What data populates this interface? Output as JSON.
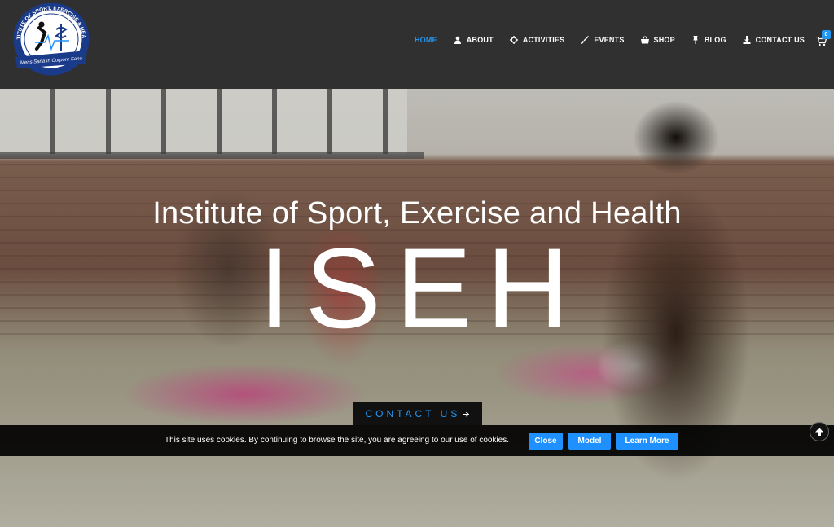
{
  "header": {
    "logo": {
      "ring_text": "INSTITUTE OF SPORT, EXERCISE & HEALTH",
      "motto": "Mens Sana In Corpore Sano",
      "colors": {
        "ring": "#1a3a8a",
        "banner": "#1a3a8a",
        "inner": "#ffffff"
      }
    },
    "nav": [
      {
        "label": "HOME",
        "icon": "",
        "active": true
      },
      {
        "label": "ABOUT",
        "icon": "user-icon",
        "active": false
      },
      {
        "label": "ACTIVITIES",
        "icon": "gear-icon",
        "active": false
      },
      {
        "label": "EVENTS",
        "icon": "brush-icon",
        "active": false
      },
      {
        "label": "SHOP",
        "icon": "basket-icon",
        "active": false
      },
      {
        "label": "BLOG",
        "icon": "pin-icon",
        "active": false
      },
      {
        "label": "CONTACT US",
        "icon": "download-icon",
        "active": false
      }
    ],
    "cart": {
      "icon": "cart-icon",
      "count": "0"
    }
  },
  "hero": {
    "subtitle": "Institute of Sport, Exercise and Health",
    "title": "ISEH",
    "cta_label": "CONTACT US",
    "cta_icon": "arrow-right-icon"
  },
  "cookie_bar": {
    "text": "This site uses cookies. By continuing to browse the site, you are agreeing to our use of cookies.",
    "close_label": "Close",
    "model_label": "Model",
    "learn_more_label": "Learn More"
  },
  "scroll_top": {
    "icon": "arrow-up-icon"
  },
  "colors": {
    "accent": "#2196f3",
    "header_bg": "#303030",
    "cookie_button": "#1e90ff"
  }
}
